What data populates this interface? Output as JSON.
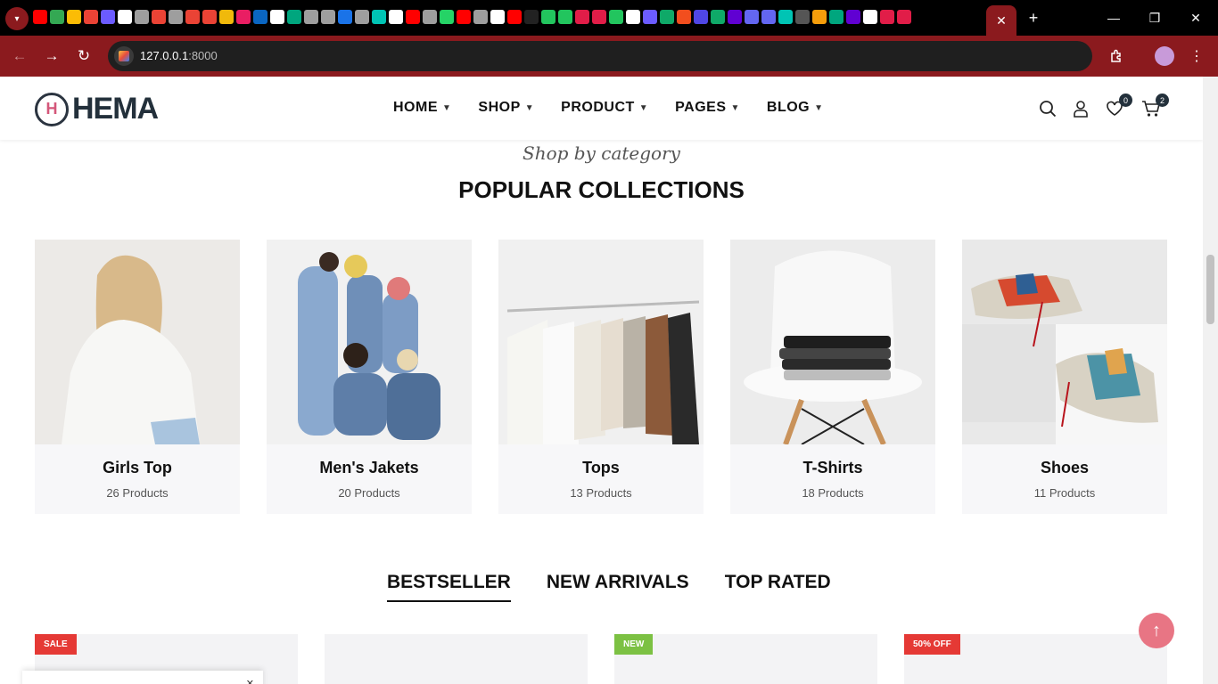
{
  "browser": {
    "url_host": "127.0.0.1",
    "url_port": ":8000",
    "active_tab_close": "✕",
    "new_tab": "+",
    "window_controls": [
      "—",
      "❐",
      "✕"
    ],
    "favicon_colors": [
      "#ff0000",
      "#34a853",
      "#fbbc05",
      "#ea4335",
      "#6b5bff",
      "#ffffff",
      "#9e9e9e",
      "#ea4335",
      "#9e9e9e",
      "#ea4335",
      "#ea4335",
      "#f0b90b",
      "#e91e63",
      "#0a66c2",
      "#ffffff",
      "#00a67e",
      "#9e9e9e",
      "#9e9e9e",
      "#1a73e8",
      "#9e9e9e",
      "#00c4b4",
      "#ffffff",
      "#ff0000",
      "#9e9e9e",
      "#25d366",
      "#ff0000",
      "#9e9e9e",
      "#ffffff",
      "#ff0000",
      "#222222",
      "#22c55e",
      "#22c55e",
      "#e11d48",
      "#e11d48",
      "#22c55e",
      "#ffffff",
      "#6b5bff",
      "#0fa968",
      "#f24e1e",
      "#4f46e5",
      "#0fa968",
      "#6001d2",
      "#6366f1",
      "#6366f1",
      "#00c4b4",
      "#555555",
      "#f59e0b",
      "#00a67e",
      "#6001d2",
      "#ffffff",
      "#e11d48",
      "#e11d48"
    ]
  },
  "header": {
    "logo_mark": "H",
    "logo_text": "HEMA",
    "menu": [
      {
        "label": "HOME"
      },
      {
        "label": "SHOP"
      },
      {
        "label": "PRODUCT"
      },
      {
        "label": "PAGES"
      },
      {
        "label": "BLOG"
      }
    ],
    "wishlist_count": "0",
    "cart_count": "2"
  },
  "collections": {
    "subtitle": "Shop by category",
    "title": "POPULAR COLLECTIONS",
    "items": [
      {
        "name": "Girls Top",
        "count": "26 Products"
      },
      {
        "name": "Men's Jakets",
        "count": "20 Products"
      },
      {
        "name": "Tops",
        "count": "13 Products"
      },
      {
        "name": "T-Shirts",
        "count": "18 Products"
      },
      {
        "name": "Shoes",
        "count": "11 Products"
      }
    ]
  },
  "product_tabs": [
    "BESTSELLER",
    "NEW ARRIVALS",
    "TOP RATED"
  ],
  "product_labels": [
    {
      "text": "SALE",
      "color": "#e53935"
    },
    {
      "text": "",
      "color": ""
    },
    {
      "text": "NEW",
      "color": "#7cc143"
    },
    {
      "text": "50% OFF",
      "color": "#e53935"
    }
  ],
  "popup_close": "✕",
  "to_top": "↑"
}
